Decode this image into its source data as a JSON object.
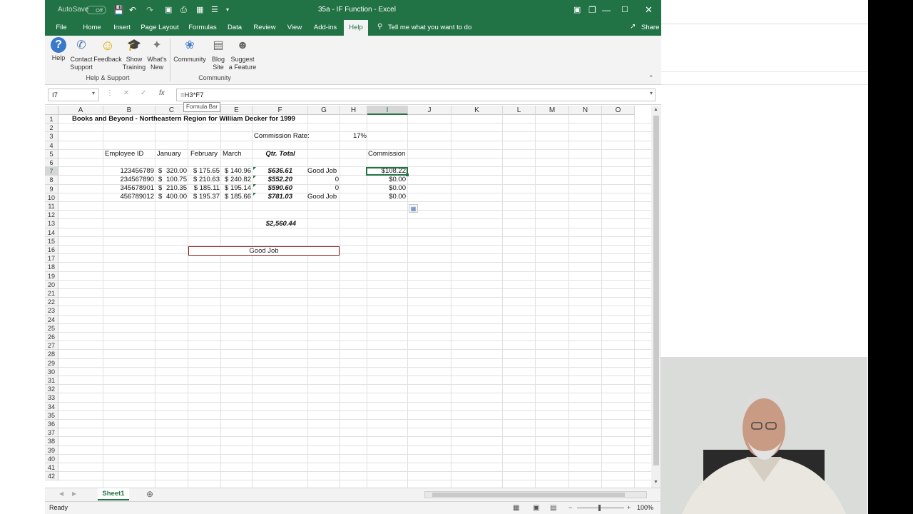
{
  "window": {
    "title": "35a - IF Function  -  Excel",
    "autosave_label": "AutoSave",
    "autosave_state": "Off"
  },
  "tabs": [
    "File",
    "Home",
    "Insert",
    "Page Layout",
    "Formulas",
    "Data",
    "Review",
    "View",
    "Add-ins",
    "Help"
  ],
  "active_tab": "Help",
  "tell_me": "Tell me what you want to do",
  "share_label": "Share",
  "ribbon": {
    "help_support": {
      "group": "Help & Support",
      "buttons": [
        {
          "line1": "Help",
          "line2": ""
        },
        {
          "line1": "Contact",
          "line2": "Support"
        },
        {
          "line1": "Feedback",
          "line2": ""
        },
        {
          "line1": "Show",
          "line2": "Training"
        },
        {
          "line1": "What's",
          "line2": "New"
        }
      ]
    },
    "community": {
      "group": "Community",
      "buttons": [
        {
          "line1": "Community",
          "line2": ""
        },
        {
          "line1": "Blog",
          "line2": "Site"
        },
        {
          "line1": "Suggest",
          "line2": "a Feature"
        }
      ]
    }
  },
  "formula_bar": {
    "name_box": "I7",
    "fx": "fx",
    "formula": "=H3*F7",
    "tooltip": "Formula Bar"
  },
  "columns": [
    "A",
    "B",
    "C",
    "D",
    "E",
    "F",
    "G",
    "H",
    "I",
    "J",
    "K",
    "L",
    "M",
    "N",
    "O"
  ],
  "selected_column": "I",
  "rows": [
    "1",
    "2",
    "3",
    "4",
    "5",
    "6",
    "7",
    "8",
    "9",
    "10",
    "11",
    "12",
    "13",
    "14",
    "15",
    "16",
    "17",
    "18",
    "19",
    "20",
    "21",
    "22",
    "23",
    "24",
    "25",
    "26",
    "27",
    "28",
    "29",
    "30",
    "31",
    "32",
    "33",
    "34",
    "35",
    "36",
    "37",
    "38",
    "39",
    "40",
    "41",
    "42"
  ],
  "selected_row": "7",
  "sheet": {
    "title": "Books and Beyond - Northeastern Region for William Decker for 1999",
    "commission_rate_label": "Commission Rate:",
    "commission_rate": "17%",
    "headers": {
      "employee_id": "Employee ID",
      "january": "January",
      "february": "February",
      "march": "March",
      "qtr_total": "Qtr. Total",
      "commission": "Commission"
    },
    "data_rows": [
      {
        "row": "7",
        "id": "123456789",
        "jan_sym": "$",
        "jan": "320.00",
        "feb": "$ 175.65",
        "mar": "$ 140.96",
        "total": "$636.61",
        "g": "Good Job",
        "comm": "$108.22"
      },
      {
        "row": "8",
        "id": "234567890",
        "jan_sym": "$",
        "jan": "100.75",
        "feb": "$ 210.63",
        "mar": "$ 240.82",
        "total": "$552.20",
        "g": "0",
        "comm": "$0.00"
      },
      {
        "row": "9",
        "id": "345678901",
        "jan_sym": "$",
        "jan": "210.35",
        "feb": "$ 185.11",
        "mar": "$ 195.14",
        "total": "$590.60",
        "g": "0",
        "comm": "$0.00"
      },
      {
        "row": "10",
        "id": "456789012",
        "jan_sym": "$",
        "jan": "400.00",
        "feb": "$ 195.37",
        "mar": "$ 185.66",
        "total": "$781.03",
        "g": "Good Job",
        "comm": "$0.00"
      }
    ],
    "grand_total": "$2,560.44",
    "merged_cell_text": "Good Job"
  },
  "sheet_tab": "Sheet1",
  "status": {
    "ready": "Ready",
    "zoom": "100%"
  },
  "colors": {
    "excel_green": "#217346",
    "merged_border": "#8b1a1a"
  }
}
